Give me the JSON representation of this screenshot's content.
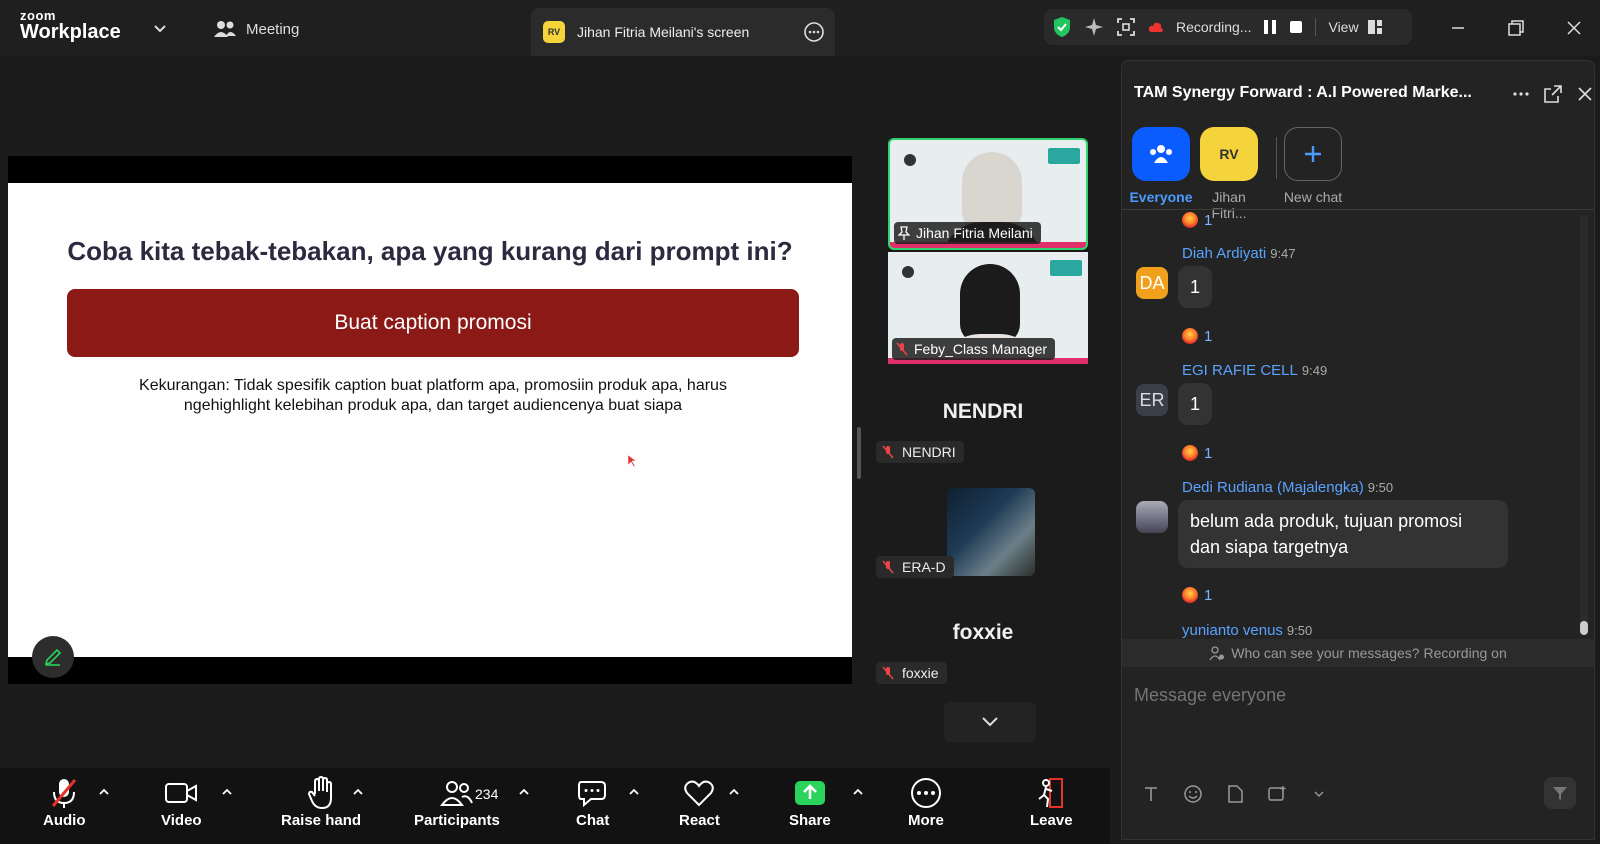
{
  "topbar": {
    "logo_small": "zoom",
    "logo_big": "Workplace",
    "meeting_label": "Meeting",
    "screen_tab_label": "Jihan Fitria Meilani's screen",
    "recording_label": "Recording...",
    "view_label": "View"
  },
  "slide": {
    "title": "Coba kita tebak-tebakan, apa yang kurang dari prompt ini?",
    "banner": "Buat caption promosi",
    "note": "Kekurangan: Tidak spesifik caption buat platform apa, promosiin produk apa, harus ngehighlight kelebihan produk apa, dan target audiencenya buat siapa"
  },
  "gallery": {
    "tiles": [
      {
        "name": "Jihan Fitria Meilani"
      },
      {
        "name": "Feby_Class Manager"
      }
    ],
    "nendri_big": "NENDRI",
    "nendri_tag": "NENDRI",
    "era_tag": "ERA-D",
    "foxxie_big": "foxxie",
    "foxxie_tag": "foxxie"
  },
  "chat": {
    "title": "TAM Synergy Forward : A.I Powered Marke...",
    "channels": [
      {
        "label": "Everyone"
      },
      {
        "label": "Jihan Fitri..."
      },
      {
        "label": "New chat"
      }
    ],
    "messages": [
      {
        "reaction_count": "1"
      },
      {
        "sender": "Diah Ardiyati",
        "time": "9:47",
        "initials": "DA",
        "text": "1",
        "reaction_count": "1"
      },
      {
        "sender": "EGI RAFIE CELL",
        "time": "9:49",
        "initials": "ER",
        "text": "1",
        "reaction_count": "1"
      },
      {
        "sender": "Dedi Rudiana (Majalengka)",
        "time": "9:50",
        "text": "belum ada produk, tujuan promosi dan siapa targetnya",
        "reaction_count": "1"
      },
      {
        "sender": "yunianto venus",
        "time": "9:50"
      }
    ],
    "visibility_note": "Who can see your messages? Recording on",
    "input_placeholder": "Message everyone"
  },
  "toolbar": {
    "audio": "Audio",
    "video": "Video",
    "raise_hand": "Raise hand",
    "participants": "Participants",
    "participants_count": "234",
    "chat": "Chat",
    "react": "React",
    "share": "Share",
    "more": "More",
    "leave": "Leave"
  },
  "colors": {
    "accent_blue": "#0b5cff",
    "share_green": "#2ad35b",
    "banner_red": "#8b1a16",
    "active_border": "#32d470"
  }
}
